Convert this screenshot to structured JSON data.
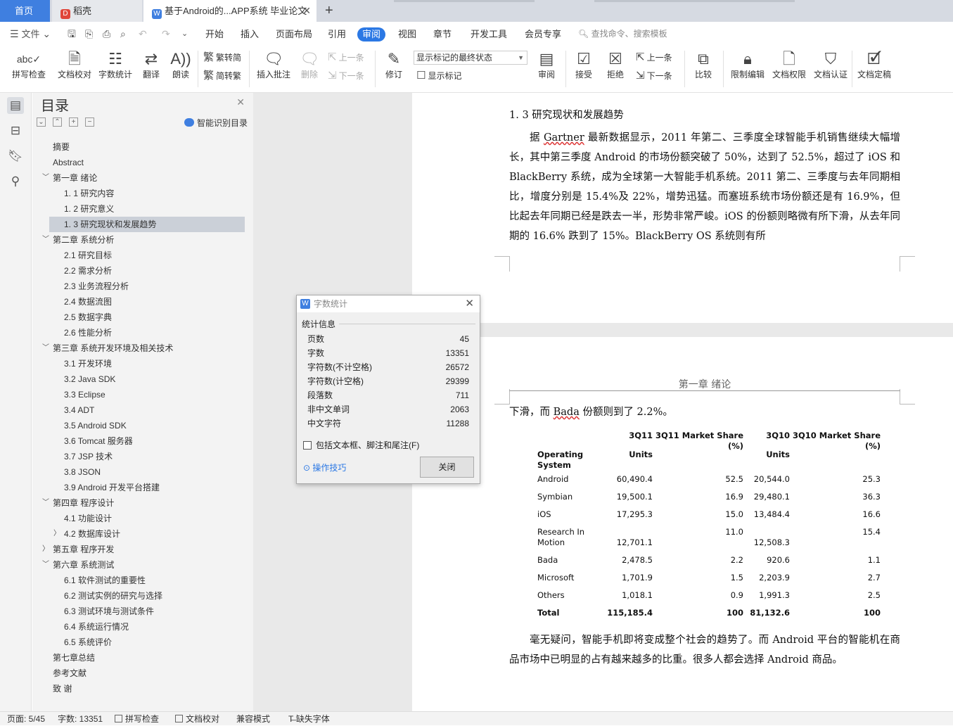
{
  "tabs": {
    "home": "首页",
    "tab1": "稻壳",
    "tab2": "基于Android的...APP系统 毕业论文"
  },
  "menu": {
    "file": "文件",
    "items": [
      "开始",
      "插入",
      "页面布局",
      "引用",
      "审阅",
      "视图",
      "章节",
      "开发工具",
      "会员专享"
    ],
    "search_placeholder": "查找命令、搜索模板"
  },
  "ribbon": {
    "spellcheck": "拼写检查",
    "doc_check": "文档校对",
    "word_count": "字数统计",
    "translate": "翻译",
    "read_aloud": "朗读",
    "trad": "繁转简",
    "simp": "简转繁",
    "insert_comment": "插入批注",
    "delete": "删除",
    "prev_comment": "上一条",
    "next_comment": "下一条",
    "track": "修订",
    "markup_select": "显示标记的最终状态",
    "show_markup": "显示标记",
    "review": "审阅",
    "accept": "接受",
    "reject": "拒绝",
    "prev_change": "上一条",
    "next_change": "下一条",
    "compare": "比较",
    "restrict": "限制编辑",
    "permission": "文档权限",
    "certify": "文档认证",
    "finalize": "文档定稿"
  },
  "nav": {
    "title": "目录",
    "smart_toc": "智能识别目录",
    "items": [
      {
        "t": "摘要"
      },
      {
        "t": "Abstract"
      },
      {
        "t": "第一章 绪论"
      },
      {
        "t": "1. 1 研究内容"
      },
      {
        "t": "1. 2 研究意义"
      },
      {
        "t": "1. 3 研究现状和发展趋势"
      },
      {
        "t": "第二章  系统分析"
      },
      {
        "t": "2.1 研究目标"
      },
      {
        "t": "2.2 需求分析"
      },
      {
        "t": "2.3 业务流程分析"
      },
      {
        "t": "2.4 数据流图"
      },
      {
        "t": "2.5 数据字典"
      },
      {
        "t": "2.6 性能分析"
      },
      {
        "t": "第三章 系统开发环境及相关技术"
      },
      {
        "t": "3.1 开发环境"
      },
      {
        "t": "3.2 Java SDK"
      },
      {
        "t": "3.3 Eclipse"
      },
      {
        "t": "3.4 ADT"
      },
      {
        "t": "3.5 Android SDK"
      },
      {
        "t": "3.6 Tomcat 服务器"
      },
      {
        "t": "3.7 JSP 技术"
      },
      {
        "t": "3.8 JSON"
      },
      {
        "t": "3.9 Android 开发平台搭建"
      },
      {
        "t": "第四章 程序设计"
      },
      {
        "t": "4.1   功能设计"
      },
      {
        "t": "4.2   数据库设计"
      },
      {
        "t": "第五章 程序开发"
      },
      {
        "t": "第六章   系统测试"
      },
      {
        "t": "6.1   软件测试的重要性"
      },
      {
        "t": "6.2   测试实例的研究与选择"
      },
      {
        "t": "6.3   测试环境与测试条件"
      },
      {
        "t": "6.4   系统运行情况"
      },
      {
        "t": "6.5   系统评价"
      },
      {
        "t": "第七章总结"
      },
      {
        "t": "参考文献"
      },
      {
        "t": "致  谢"
      }
    ]
  },
  "doc": {
    "heading": "1. 3 研究现状和发展趋势",
    "para1_a": "据 ",
    "para1_gartner": "Gartner",
    "para1_b": " 最新数据显示，2011 年第二、三季度全球智能手机销售继续大幅增长，其中第三季度 Android 的市场份额突破了 50%，达到了 52.5%，超过了 iOS 和 BlackBerry 系统，成为全球第一大智能手机系统。2011 第二、三季度与去年同期相比，增度分别是 15.4%及 22%，增势迅猛。而塞班系统市场份额还是有 16.9%，但比起去年同期已经是跌去一半，形势非常严峻。iOS 的份额则略微有所下滑，从去年同期的 16.6% 跌到了 15%。BlackBerry OS 系统则有所",
    "page_header": "第一章 绪论",
    "cont_a": "下滑，而 ",
    "cont_bada": "Bada",
    "cont_b": " 份额则到了 2.2%。",
    "para2": "毫无疑问，智能手机即将变成整个社会的趋势了。而 Android 平台的智能机在商品市场中已明显的占有越来越多的比重。很多人都会选择 Android 商品。"
  },
  "table": {
    "head": {
      "os": "Operating System",
      "q11u_top": "3Q11",
      "q11u_bot": "Units",
      "q11s": "3Q11 Market Share (%)",
      "q10u_top": "3Q10",
      "q10u_bot": "Units",
      "q10s": "3Q10 Market Share (%)"
    },
    "rows": [
      {
        "os": "Android",
        "u11": "60,490.4",
        "s11": "52.5",
        "u10": "20,544.0",
        "s10": "25.3"
      },
      {
        "os": "Symbian",
        "u11": "19,500.1",
        "s11": "16.9",
        "u10": "29,480.1",
        "s10": "36.3"
      },
      {
        "os": "iOS",
        "u11": "17,295.3",
        "s11": "15.0",
        "u10": "13,484.4",
        "s10": "16.6"
      },
      {
        "os": "Research In Motion",
        "u11": "12,701.1",
        "s11": "11.0",
        "u10": "12,508.3",
        "s10": "15.4"
      },
      {
        "os": "Bada",
        "u11": "2,478.5",
        "s11": "2.2",
        "u10": "920.6",
        "s10": "1.1"
      },
      {
        "os": "Microsoft",
        "u11": "1,701.9",
        "s11": "1.5",
        "u10": "2,203.9",
        "s10": "2.7"
      },
      {
        "os": "Others",
        "u11": "1,018.1",
        "s11": "0.9",
        "u10": "1,991.3",
        "s10": "2.5"
      },
      {
        "os": "Total",
        "u11": "115,185.4",
        "s11": "100",
        "u10": "81,132.6",
        "s10": "100"
      }
    ]
  },
  "dialog": {
    "title": "字数统计",
    "group": "统计信息",
    "stats": [
      {
        "k": "页数",
        "v": "45"
      },
      {
        "k": "字数",
        "v": "13351"
      },
      {
        "k": "字符数(不计空格)",
        "v": "26572"
      },
      {
        "k": "字符数(计空格)",
        "v": "29399"
      },
      {
        "k": "段落数",
        "v": "711"
      },
      {
        "k": "非中文单词",
        "v": "2063"
      },
      {
        "k": "中文字符",
        "v": "11288"
      }
    ],
    "checkbox": "包括文本框、脚注和尾注(F)",
    "tips": "操作技巧",
    "close": "关闭"
  },
  "status": {
    "page": "页面: 5/45",
    "words": "字数: 13351",
    "spell": "拼写检查",
    "check": "文档校对",
    "compat": "兼容模式",
    "missing_font": "缺失字体"
  }
}
